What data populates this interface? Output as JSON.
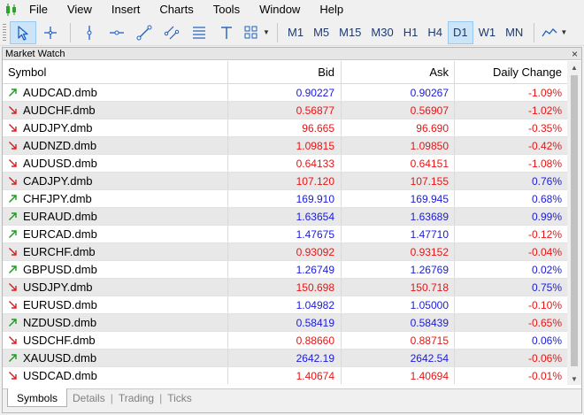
{
  "menu": [
    "File",
    "View",
    "Insert",
    "Charts",
    "Tools",
    "Window",
    "Help"
  ],
  "toolbar": {
    "tools": [
      "cursor-icon",
      "crosshair-icon",
      "vertical-line-icon",
      "horizontal-line-icon",
      "trendline-icon",
      "channel-icon",
      "fibonacci-icon",
      "text-icon",
      "shapes-icon"
    ],
    "timeframes": [
      "M1",
      "M5",
      "M15",
      "M30",
      "H1",
      "H4",
      "D1",
      "W1",
      "MN"
    ],
    "active_timeframe": "D1"
  },
  "panel": {
    "title": "Market Watch",
    "close": "×"
  },
  "columns": {
    "symbol": "Symbol",
    "bid": "Bid",
    "ask": "Ask",
    "change": "Daily Change"
  },
  "colors": {
    "up_arrow": "#1a9a1a",
    "down_arrow": "#d42020",
    "blue": "#1a1adc",
    "red": "#e81414",
    "active_bg": "#cce4f7"
  },
  "rows": [
    {
      "symbol": "AUDCAD.dmb",
      "dir": "up",
      "bid": "0.90227",
      "bid_color": "blue",
      "ask": "0.90267",
      "ask_color": "blue",
      "change": "-1.09%",
      "change_color": "red"
    },
    {
      "symbol": "AUDCHF.dmb",
      "dir": "down",
      "bid": "0.56877",
      "bid_color": "red",
      "ask": "0.56907",
      "ask_color": "red",
      "change": "-1.02%",
      "change_color": "red"
    },
    {
      "symbol": "AUDJPY.dmb",
      "dir": "down",
      "bid": "96.665",
      "bid_color": "red",
      "ask": "96.690",
      "ask_color": "red",
      "change": "-0.35%",
      "change_color": "red"
    },
    {
      "symbol": "AUDNZD.dmb",
      "dir": "down",
      "bid": "1.09815",
      "bid_color": "red",
      "ask": "1.09850",
      "ask_color": "red",
      "change": "-0.42%",
      "change_color": "red"
    },
    {
      "symbol": "AUDUSD.dmb",
      "dir": "down",
      "bid": "0.64133",
      "bid_color": "red",
      "ask": "0.64151",
      "ask_color": "red",
      "change": "-1.08%",
      "change_color": "red"
    },
    {
      "symbol": "CADJPY.dmb",
      "dir": "down",
      "bid": "107.120",
      "bid_color": "red",
      "ask": "107.155",
      "ask_color": "red",
      "change": "0.76%",
      "change_color": "blue"
    },
    {
      "symbol": "CHFJPY.dmb",
      "dir": "up",
      "bid": "169.910",
      "bid_color": "blue",
      "ask": "169.945",
      "ask_color": "blue",
      "change": "0.68%",
      "change_color": "blue"
    },
    {
      "symbol": "EURAUD.dmb",
      "dir": "up",
      "bid": "1.63654",
      "bid_color": "blue",
      "ask": "1.63689",
      "ask_color": "blue",
      "change": "0.99%",
      "change_color": "blue"
    },
    {
      "symbol": "EURCAD.dmb",
      "dir": "up",
      "bid": "1.47675",
      "bid_color": "blue",
      "ask": "1.47710",
      "ask_color": "blue",
      "change": "-0.12%",
      "change_color": "red"
    },
    {
      "symbol": "EURCHF.dmb",
      "dir": "down",
      "bid": "0.93092",
      "bid_color": "red",
      "ask": "0.93152",
      "ask_color": "red",
      "change": "-0.04%",
      "change_color": "red"
    },
    {
      "symbol": "GBPUSD.dmb",
      "dir": "up",
      "bid": "1.26749",
      "bid_color": "blue",
      "ask": "1.26769",
      "ask_color": "blue",
      "change": "0.02%",
      "change_color": "blue"
    },
    {
      "symbol": "USDJPY.dmb",
      "dir": "down",
      "bid": "150.698",
      "bid_color": "red",
      "ask": "150.718",
      "ask_color": "red",
      "change": "0.75%",
      "change_color": "blue"
    },
    {
      "symbol": "EURUSD.dmb",
      "dir": "down",
      "bid": "1.04982",
      "bid_color": "blue",
      "ask": "1.05000",
      "ask_color": "blue",
      "change": "-0.10%",
      "change_color": "red"
    },
    {
      "symbol": "NZDUSD.dmb",
      "dir": "up",
      "bid": "0.58419",
      "bid_color": "blue",
      "ask": "0.58439",
      "ask_color": "blue",
      "change": "-0.65%",
      "change_color": "red"
    },
    {
      "symbol": "USDCHF.dmb",
      "dir": "down",
      "bid": "0.88660",
      "bid_color": "red",
      "ask": "0.88715",
      "ask_color": "red",
      "change": "0.06%",
      "change_color": "blue"
    },
    {
      "symbol": "XAUUSD.dmb",
      "dir": "up",
      "bid": "2642.19",
      "bid_color": "blue",
      "ask": "2642.54",
      "ask_color": "blue",
      "change": "-0.06%",
      "change_color": "red"
    },
    {
      "symbol": "USDCAD.dmb",
      "dir": "down",
      "bid": "1.40674",
      "bid_color": "red",
      "ask": "1.40694",
      "ask_color": "red",
      "change": "-0.01%",
      "change_color": "red"
    }
  ],
  "tabs": [
    "Symbols",
    "Details",
    "Trading",
    "Ticks"
  ],
  "active_tab": "Symbols"
}
